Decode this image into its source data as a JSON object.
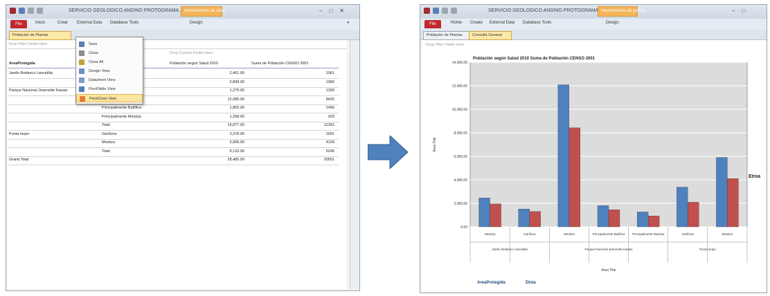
{
  "left_window": {
    "title": "SERVICIO GEOLOGICO ANDINO PROTOGRAMA...",
    "context_tab": "Herramientas de tabla",
    "file_tab": "File",
    "ribbon_tabs": [
      "Inicio",
      "Crear",
      "External Data",
      "Database Tools",
      "Design"
    ],
    "doc_tab": "Población de Plantas",
    "filter_hint": "Drop Filter Fields Here",
    "column_hint": "Drop Column Fields Here",
    "headers": [
      "AreaProtegida",
      "Población según Salud 2010",
      "Suma de Población CENSO 2001"
    ],
    "rows": [
      {
        "area": "Jardín Botánico Lancetilla",
        "sub": "",
        "v1": "2,461.00",
        "v2": "1961"
      },
      {
        "area": "",
        "sub": "",
        "v1": "2,899.00",
        "v2": "1966"
      },
      {
        "area": "Parque Nacional Jeannette Kawas",
        "sub": "",
        "v1": "1,275.00",
        "v2": "1309"
      },
      {
        "area": "",
        "sub": "",
        "v1": "12,085.00",
        "v2": "8425"
      },
      {
        "area": "",
        "sub": "Principalmente Bailífica",
        "v1": "1,802.00",
        "v2": "1456"
      },
      {
        "area": "",
        "sub": "Principalmente Mestiza",
        "v1": "1,268.00",
        "v2": "929"
      },
      {
        "area": "",
        "sub": "Total",
        "v1": "16,877.00",
        "v2": "12391"
      },
      {
        "area": "Punta Izopo",
        "sub": "Garífuna",
        "v1": "3,378.00",
        "v2": "2091"
      },
      {
        "area": "",
        "sub": "Mestiza",
        "v1": "5,905.00",
        "v2": "4109"
      },
      {
        "area": "",
        "sub": "Total",
        "v1": "9,133.00",
        "v2": "6249"
      },
      {
        "area": "Grand Total",
        "sub": "",
        "v1": "28,485.00",
        "v2": "20501"
      }
    ],
    "context_menu": [
      "Save",
      "Close",
      "Close All",
      "Design View",
      "Datasheet View",
      "PivotTable View",
      "PivotChart View"
    ],
    "context_menu_highlight": 6
  },
  "right_window": {
    "title": "SERVICIO GEOLOGICO ANDINO PROTOGRAMA...",
    "context_tab": "Herramientas de gráfico",
    "file_tab": "File",
    "ribbon_tabs": [
      "Home",
      "Create",
      "External Data",
      "Database Tools",
      "Design"
    ],
    "doc_tabs": [
      "Población de Plantas",
      "Consulta General"
    ],
    "active_doc_tab": 1,
    "filter_hint": "Drop Filter Fields Here",
    "side_label": "Etnia"
  },
  "chart_data": {
    "type": "bar",
    "title": "Población según Salud 2010  Suma de Población CENSO 2001",
    "xlabel": "Area Title",
    "ylabel": "Area Title",
    "ylim": [
      0,
      14000
    ],
    "yticks": [
      "0.00",
      "2,000.00",
      "4,000.00",
      "6,000.00",
      "8,000.00",
      "10,000.00",
      "12,000.00",
      "14,000.00"
    ],
    "categories": [
      "Mestiza",
      "Garifuna",
      "Mestiza",
      "Principalmente Bailífica",
      "Principalmente Mestiza",
      "Garifuna",
      "Mestiza"
    ],
    "groups": [
      {
        "label": "Jardín Botánico Lancetilla",
        "span": 2
      },
      {
        "label": "Parque Nacional Jeannette Kawas",
        "span": 3
      },
      {
        "label": "Punta Izopo",
        "span": 2
      }
    ],
    "series": [
      {
        "color": "#4f81bd",
        "values": [
          2461,
          1520,
          12085,
          1802,
          1268,
          3378,
          5905
        ]
      },
      {
        "color": "#c0504d",
        "values": [
          1961,
          1310,
          8425,
          1456,
          929,
          2091,
          4109
        ]
      }
    ],
    "filter_buttons": [
      "AreaProtegida",
      "Etnia"
    ],
    "legend": "right"
  },
  "arrow_color": "#4f81bd"
}
